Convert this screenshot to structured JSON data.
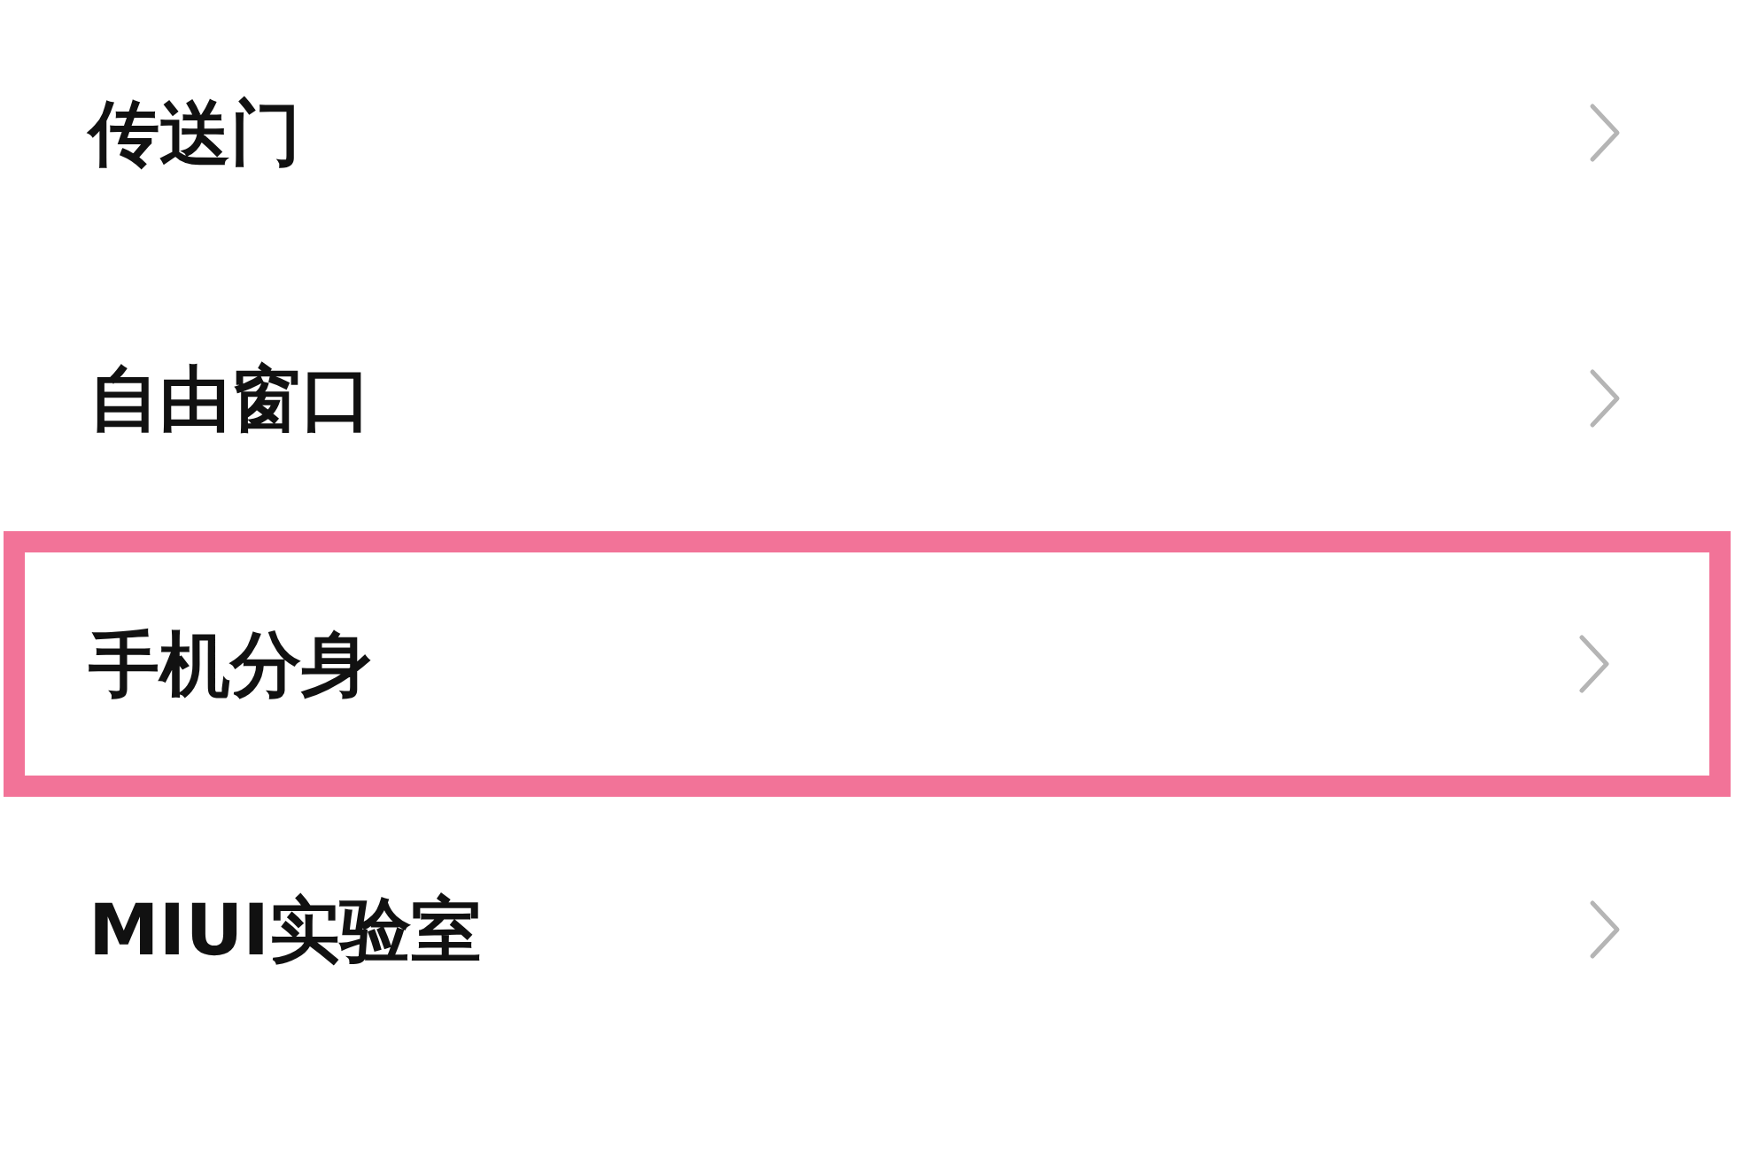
{
  "settings_items": [
    {
      "label": "传送门",
      "highlighted": false
    },
    {
      "label": "自由窗口",
      "highlighted": false
    },
    {
      "label": "手机分身",
      "highlighted": true
    },
    {
      "label": "MIUI实验室",
      "highlighted": false
    }
  ]
}
